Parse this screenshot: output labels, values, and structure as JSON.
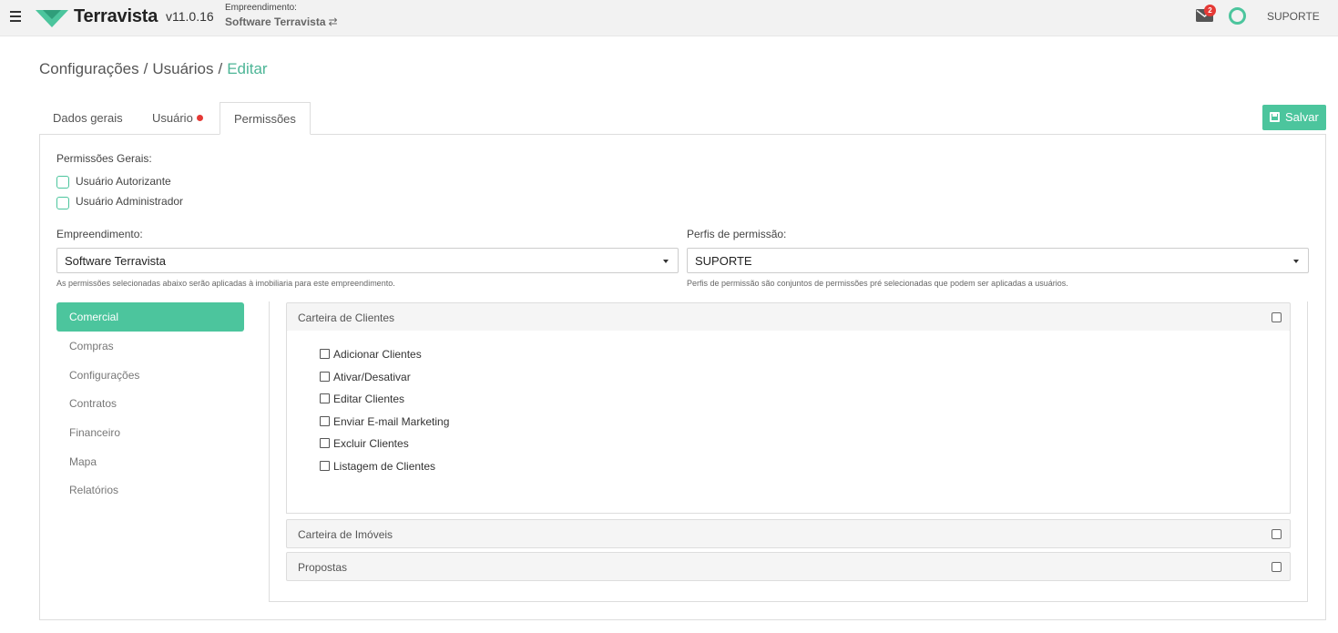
{
  "app": {
    "name": "Terravista",
    "version": "v11.0.16",
    "brand_color": "#4cc59d"
  },
  "topbar": {
    "menu_icon": "hamburger-icon",
    "empreendimento_label": "Empreendimento:",
    "empreendimento_name": "Software Terravista",
    "switch_icon": "⇄",
    "notifications_count": "2",
    "user": "SUPORTE"
  },
  "breadcrumb": {
    "items": [
      "Configurações",
      "Usuários"
    ],
    "separator": "/",
    "active": "Editar"
  },
  "tabs": [
    {
      "label": "Dados gerais",
      "active": false
    },
    {
      "label": "Usuário",
      "active": false,
      "has_alert": true
    },
    {
      "label": "Permissões",
      "active": true
    }
  ],
  "actions": {
    "save_label": "Salvar"
  },
  "general_permissions": {
    "title": "Permissões Gerais:",
    "items": [
      {
        "label": "Usuário Autorizante",
        "checked": false
      },
      {
        "label": "Usuário Administrador",
        "checked": false
      }
    ]
  },
  "empreendimento_field": {
    "label": "Empreendimento:",
    "value": "Software Terravista",
    "help": "As permissões selecionadas abaixo serão aplicadas à imobiliaria para este empreendimento."
  },
  "perfil_field": {
    "label": "Perfis de permissão:",
    "value": "SUPORTE",
    "help": "Perfis de permissão são conjuntos de permissões pré selecionadas que podem ser aplicadas a usuários."
  },
  "modules": [
    {
      "label": "Comercial",
      "active": true
    },
    {
      "label": "Compras",
      "active": false
    },
    {
      "label": "Configurações",
      "active": false
    },
    {
      "label": "Contratos",
      "active": false
    },
    {
      "label": "Financeiro",
      "active": false
    },
    {
      "label": "Mapa",
      "active": false
    },
    {
      "label": "Relatórios",
      "active": false
    }
  ],
  "sections": [
    {
      "title": "Carteira de Clientes",
      "expanded": true,
      "permissions": [
        "Adicionar Clientes",
        "Ativar/Desativar",
        "Editar Clientes",
        "Enviar E-mail Marketing",
        "Excluir Clientes",
        "Listagem de Clientes"
      ]
    },
    {
      "title": "Carteira de Imóveis",
      "expanded": false
    },
    {
      "title": "Propostas",
      "expanded": false
    }
  ]
}
